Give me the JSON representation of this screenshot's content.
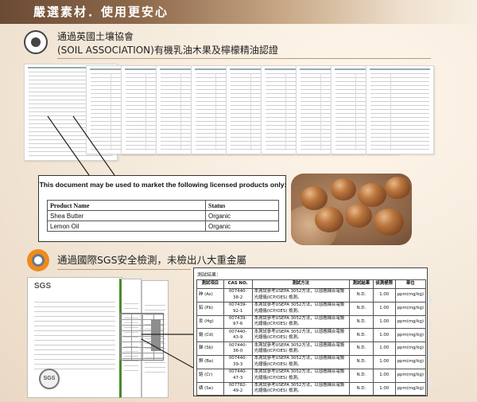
{
  "banner": {
    "title": "嚴選素材．使用更安心"
  },
  "soil_section": {
    "line1": "通過英國土壤協會",
    "line2": "(SOIL ASSOCIATION)有機乳油木果及檸檬精油認證"
  },
  "license_notice": {
    "caption": "This document may be used to market the following licensed products only:",
    "header_product": "Product Name",
    "header_status": "Status",
    "rows": [
      {
        "product": "Shea Butter",
        "status": "Organic"
      },
      {
        "product": "Lemon Oil",
        "status": "Organic"
      }
    ]
  },
  "sgs_section": {
    "headline": "通過國際SGS安全檢測，未檢出八大重金屬",
    "report_logo": "SGS",
    "seal_text": "SGS"
  },
  "metals_results": {
    "title": "測試結果：",
    "headers": [
      "測試項目",
      "CAS NO.",
      "測試方法",
      "測試結果",
      "偵測極限",
      "單位"
    ],
    "rows": [
      {
        "item": "砷 (As)",
        "cas": "007440-38-2",
        "method": "本測試參考USEPA 3052方法，以感應耦合電漿光譜儀(ICP/OES) 檢測。",
        "result": "N.D.",
        "limit": "1.00",
        "unit": "ppm(mg/kg)"
      },
      {
        "item": "鉛 (Pb)",
        "cas": "007439-92-1",
        "method": "本測試參考USEPA 3052方法，以感應耦合電漿光譜儀(ICP/OES) 檢測。",
        "result": "N.D.",
        "limit": "1.00",
        "unit": "ppm(mg/kg)"
      },
      {
        "item": "汞 (Hg)",
        "cas": "007439-97-6",
        "method": "本測試參考USEPA 3052方法，以感應耦合電漿光譜儀(ICP/OES) 檢測。",
        "result": "N.D.",
        "limit": "1.00",
        "unit": "ppm(mg/kg)"
      },
      {
        "item": "鎘 (Cd)",
        "cas": "007440-43-9",
        "method": "本測試參考USEPA 3052方法，以感應耦合電漿光譜儀(ICP/OES) 檢測。",
        "result": "N.D.",
        "limit": "1.00",
        "unit": "ppm(mg/kg)"
      },
      {
        "item": "銻 (Sb)",
        "cas": "007440-36-0",
        "method": "本測試參考USEPA 3052方法，以感應耦合電漿光譜儀(ICP/OES) 檢測。",
        "result": "N.D.",
        "limit": "1.00",
        "unit": "ppm(mg/kg)"
      },
      {
        "item": "鋇 (Ba)",
        "cas": "007440-39-3",
        "method": "本測試參考USEPA 3052方法，以感應耦合電漿光譜儀(ICP/OES) 檢測。",
        "result": "N.D.",
        "limit": "1.00",
        "unit": "ppm(mg/kg)"
      },
      {
        "item": "鉻 (Cr)",
        "cas": "007440-47-3",
        "method": "本測試參考USEPA 3052方法，以感應耦合電漿光譜儀(ICP/OES) 檢測。",
        "result": "N.D.",
        "limit": "1.00",
        "unit": "ppm(mg/kg)"
      },
      {
        "item": "硒 (Se)",
        "cas": "007782-49-2",
        "method": "本測試參考USEPA 3052方法，以感應耦合電漿光譜儀(ICP/OES) 檢測。",
        "result": "N.D.",
        "limit": "1.00",
        "unit": "ppm(mg/kg)"
      }
    ]
  },
  "icons": {
    "soil_logo": "soil-association-logo-icon",
    "sgs_logo": "sgs-certified-logo-icon"
  },
  "colors": {
    "banner_dark": "#6b4b34",
    "sgs_orange": "#f08a1c",
    "accent_line": "#b99a7b"
  }
}
